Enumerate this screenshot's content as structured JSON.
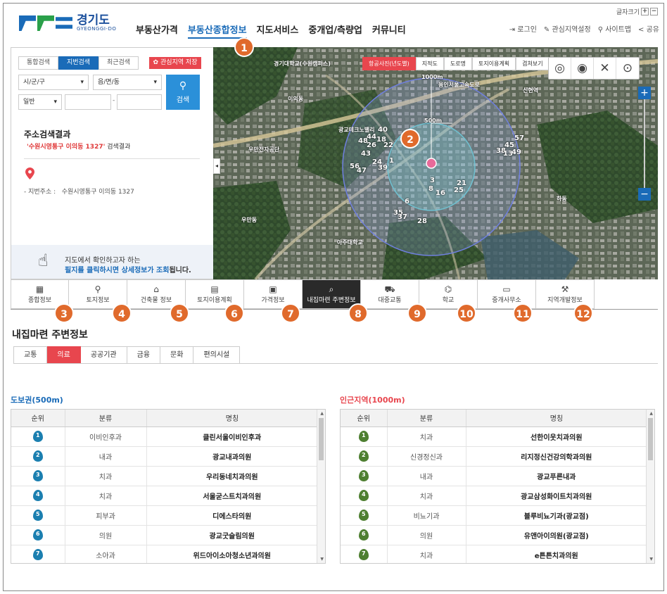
{
  "header": {
    "logo_ko": "경기도",
    "logo_en": "GYEONGGI-DO",
    "nav": [
      "부동산가격",
      "부동산종합정보",
      "지도서비스",
      "중개업/측량업",
      "커뮤니티"
    ],
    "font_size_label": "글자크기",
    "font_plus": "+",
    "font_minus": "−",
    "util": [
      "로그인",
      "관심지역설정",
      "사이트맵",
      "공유"
    ]
  },
  "search": {
    "tabs": [
      "통합검색",
      "지번검색",
      "최근검색"
    ],
    "favorite_label": "관심지역 저장",
    "sido": "시/군/구",
    "dong": "읍/면/동",
    "type": "일반",
    "dash": "-",
    "search_button": "검색"
  },
  "result": {
    "title": "주소검색결과",
    "query": "'수원시영통구 이의동 1327'",
    "query_suffix": "검색결과",
    "address_label": "- 지번주소 :",
    "address": "수원시영통구 이의동 1327"
  },
  "hint": {
    "line1": "지도에서 확인하고자 하는",
    "line2_em": "필지를 클릭하시면 상세정보가 조회",
    "line2_rest": "됩니다."
  },
  "map": {
    "tabs": [
      "항공사진(년도별)",
      "지적도",
      "도로명",
      "토지이용계획",
      "겹쳐보기"
    ],
    "zoom_in": "+",
    "zoom_out": "−",
    "radius_outer": "1000m",
    "radius_inner": "500m",
    "labels": {
      "univ": "경기대학교(수원캠퍼스)",
      "techno": "광교테크노밸리",
      "iui": "이의동",
      "ha": "하동",
      "mujeon": "우만전자공단",
      "wooman": "우만동",
      "ajou": "아주대학교",
      "express": "용인서울고속도로",
      "sinhyeon": "신현역"
    },
    "numbers": [
      "40",
      "18",
      "44",
      "48",
      "26",
      "22",
      "43",
      "1",
      "24",
      "39",
      "56",
      "47",
      "3",
      "8",
      "16",
      "21",
      "25",
      "6",
      "35",
      "37",
      "28",
      "38",
      "45",
      "57",
      "13",
      "49"
    ]
  },
  "steps": [
    "1",
    "2",
    "3",
    "4",
    "5",
    "6",
    "7",
    "8",
    "9",
    "10",
    "11",
    "12"
  ],
  "categories": [
    "종합정보",
    "토지정보",
    "건축물 정보",
    "토지이용계획",
    "가격정보",
    "내집마련 주변정보",
    "대중교통",
    "학교",
    "중개사무소",
    "지역개발정보"
  ],
  "section": {
    "title": "내집마련 주변정보",
    "subtabs": [
      "교통",
      "의료",
      "공공기관",
      "금융",
      "문화",
      "편의시설"
    ]
  },
  "table_left": {
    "title": "도보권(500m)",
    "columns": [
      "순위",
      "분류",
      "명칭"
    ],
    "rows": [
      {
        "rank": "1",
        "type": "이비인후과",
        "name": "클린서울이비인후과"
      },
      {
        "rank": "2",
        "type": "내과",
        "name": "광교내과의원"
      },
      {
        "rank": "3",
        "type": "치과",
        "name": "우리동네치과의원"
      },
      {
        "rank": "4",
        "type": "치과",
        "name": "서울굳스트치과의원"
      },
      {
        "rank": "5",
        "type": "피부과",
        "name": "디에스타의원"
      },
      {
        "rank": "6",
        "type": "의원",
        "name": "광교굿슬림의원"
      },
      {
        "rank": "7",
        "type": "소아과",
        "name": "위드아이소아청소년과의원"
      }
    ]
  },
  "table_right": {
    "title": "인근지역(1000m)",
    "columns": [
      "순위",
      "분류",
      "명칭"
    ],
    "rows": [
      {
        "rank": "1",
        "type": "치과",
        "name": "선한이웃치과의원"
      },
      {
        "rank": "2",
        "type": "신경정신과",
        "name": "리지정신건강의학과의원"
      },
      {
        "rank": "3",
        "type": "내과",
        "name": "광교푸른내과"
      },
      {
        "rank": "4",
        "type": "치과",
        "name": "광교삼성화이트치과의원"
      },
      {
        "rank": "5",
        "type": "비뇨기과",
        "name": "블루비뇨기과(광교점)"
      },
      {
        "rank": "6",
        "type": "의원",
        "name": "유앤아이의원(광교점)"
      },
      {
        "rank": "7",
        "type": "치과",
        "name": "e튼튼치과의원"
      }
    ]
  },
  "colors": {
    "accent_blue": "#1a6bb8",
    "accent_red": "#e8464e",
    "step_badge": "#e06a2c",
    "left_title": "#1a6bb8",
    "right_title": "#e8464e"
  }
}
